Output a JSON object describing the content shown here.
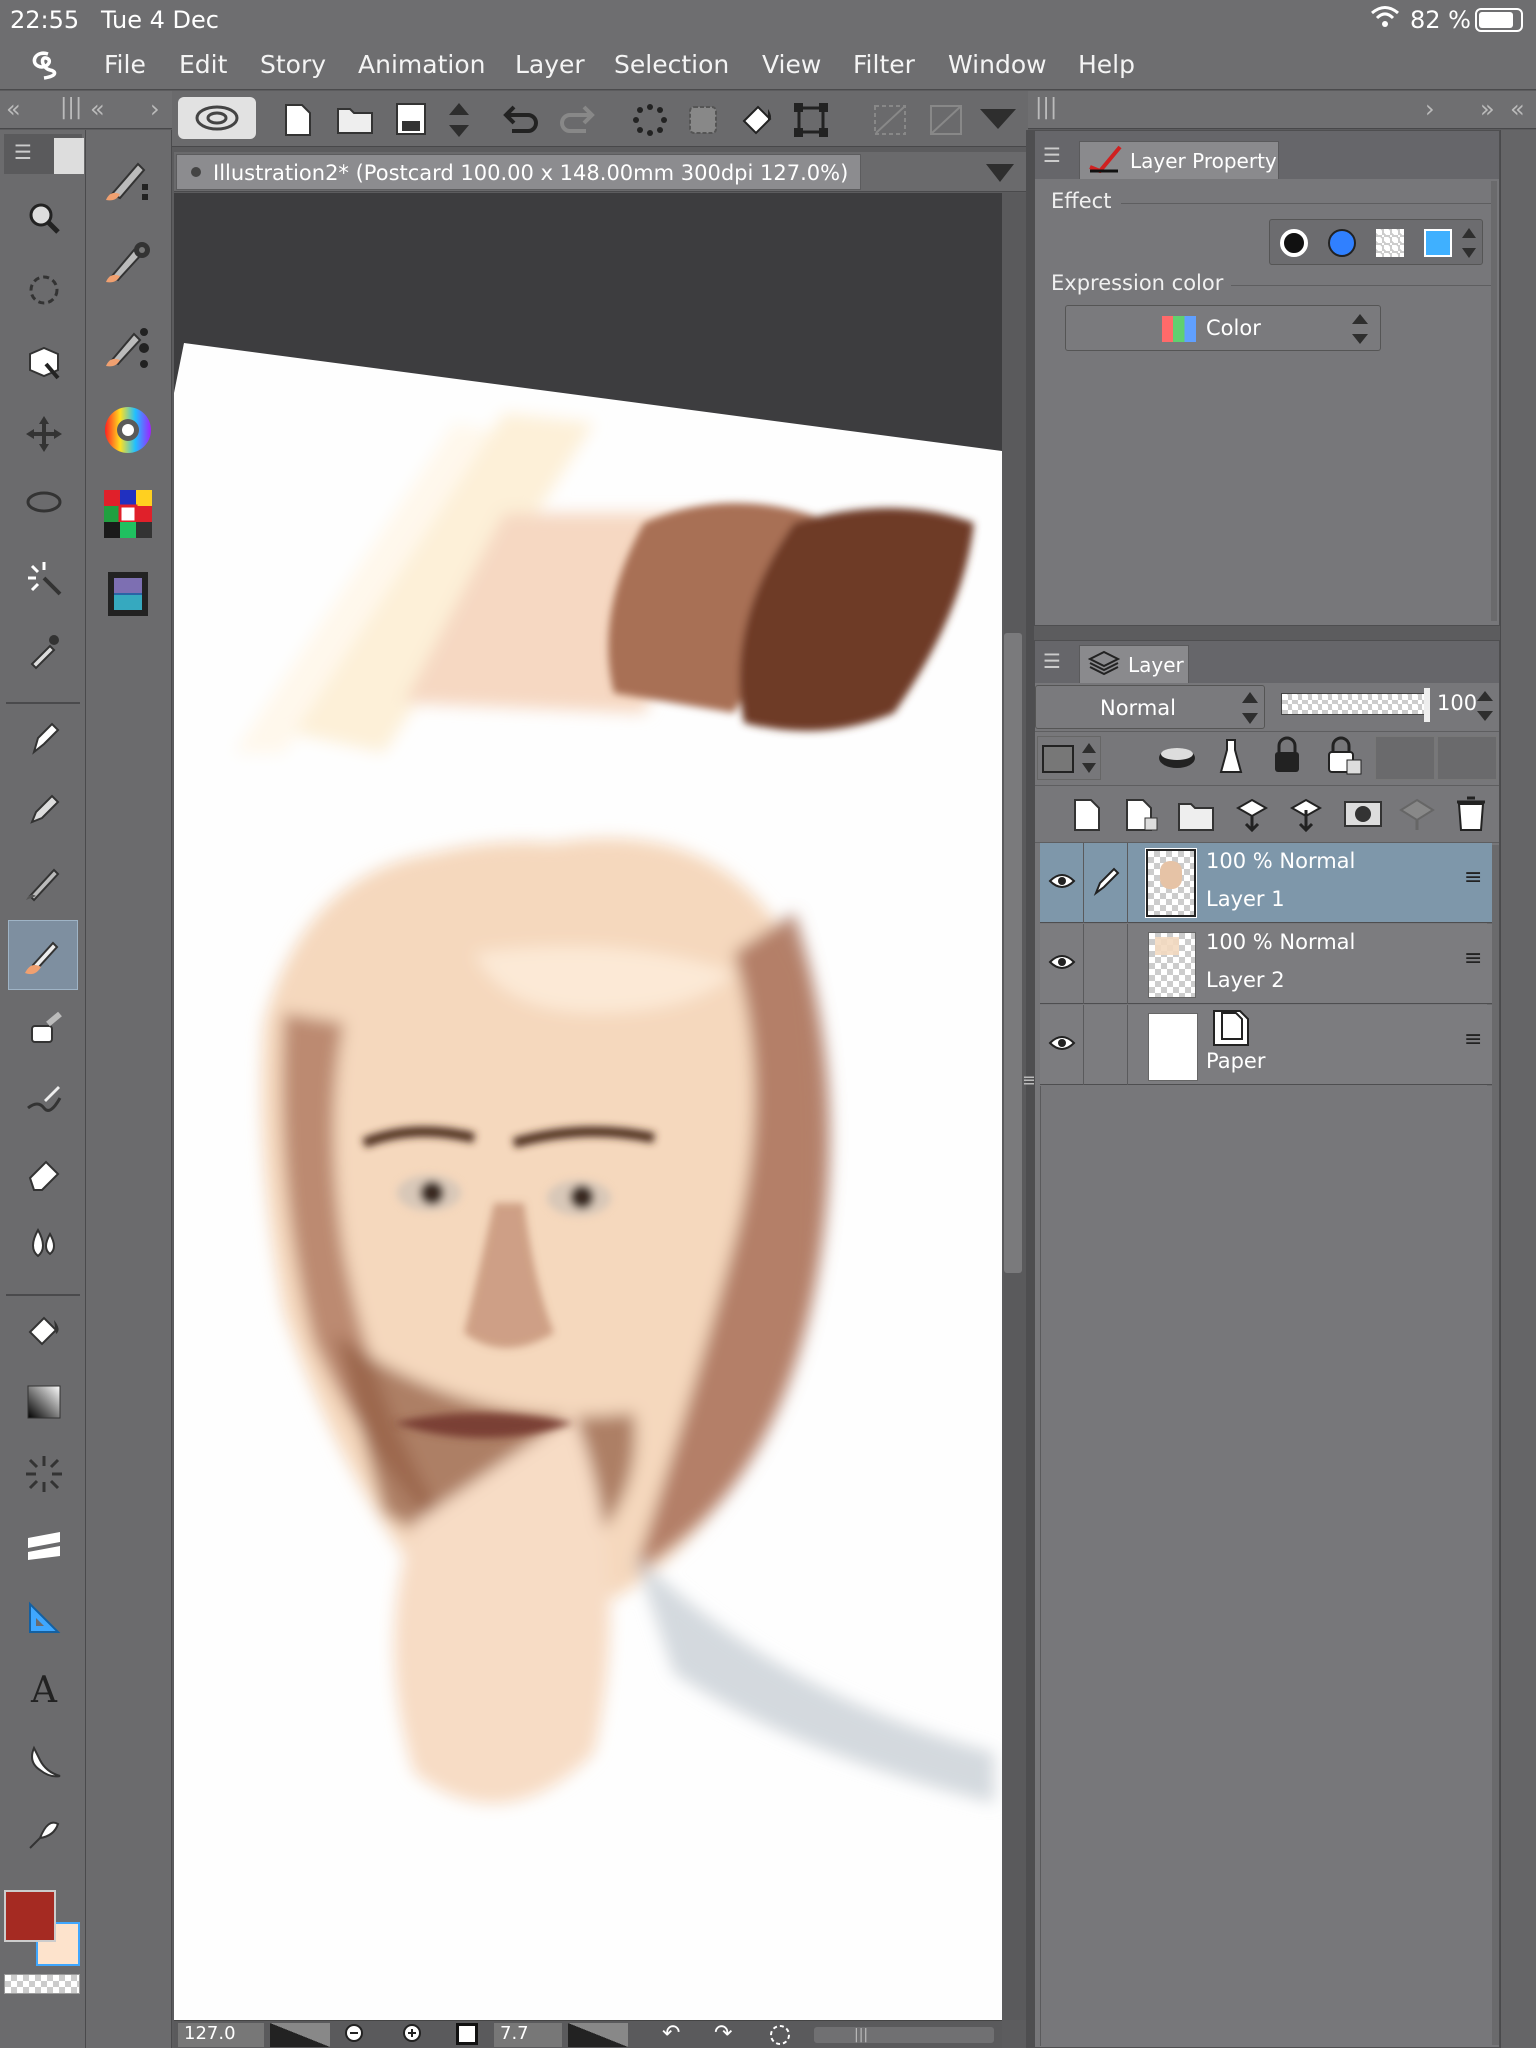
{
  "status": {
    "time": "22:55",
    "date": "Tue 4 Dec",
    "battery": "82 %"
  },
  "menu": [
    "File",
    "Edit",
    "Story",
    "Animation",
    "Layer",
    "Selection",
    "View",
    "Filter",
    "Window",
    "Help"
  ],
  "document": {
    "tab_title": "Illustration2* (Postcard 100.00 x 148.00mm 300dpi 127.0%)"
  },
  "layer_property": {
    "tab_label": "Layer Property",
    "effect_label": "Effect",
    "expression_color_label": "Expression color",
    "expression_color_value": "Color"
  },
  "layer_panel": {
    "tab_label": "Layer",
    "blend_mode": "Normal",
    "opacity": "100",
    "layers": [
      {
        "mode": "100 % Normal",
        "name": "Layer 1",
        "selected": true
      },
      {
        "mode": "100 % Normal",
        "name": "Layer 2",
        "selected": false
      },
      {
        "mode": "",
        "name": "Paper",
        "selected": false
      }
    ]
  },
  "bottom_bar": {
    "zoom": "127.0",
    "brush_size": "7.7"
  },
  "colors": {
    "main_color": "#a52a22",
    "sub_color": "#fde3cc",
    "selection_blue": "#7e97aa",
    "panel_gray": "#77777a"
  },
  "icons": [
    "app-logo-icon",
    "zoom-icon",
    "rotate-icon",
    "object-icon",
    "move-layer-icon",
    "lasso-icon",
    "magic-wand-icon",
    "eyedropper-icon",
    "pen-icon",
    "pencil-icon",
    "brush-icon",
    "blend-icon",
    "airbrush-icon",
    "decoration-icon",
    "eraser-icon",
    "fill-icon",
    "gradient-icon",
    "figure-icon",
    "frame-icon",
    "ruler-icon",
    "text-icon",
    "balloon-icon",
    "correct-line-icon"
  ]
}
